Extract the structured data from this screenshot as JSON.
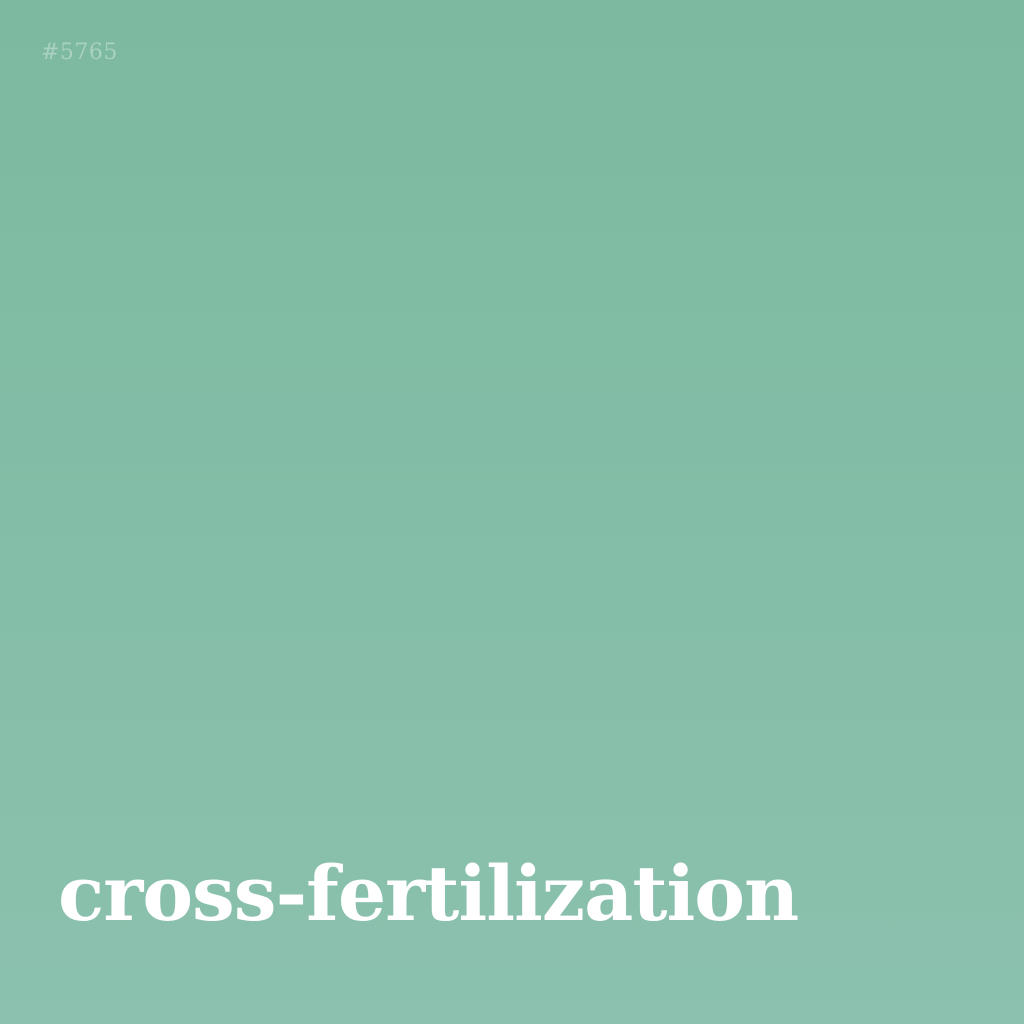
{
  "card": {
    "id_label": "#5765",
    "word": "cross-fertilization"
  },
  "colors": {
    "background_top": "#7cb9a0",
    "background_bottom": "#8bc1ae",
    "text": "#ffffff"
  }
}
